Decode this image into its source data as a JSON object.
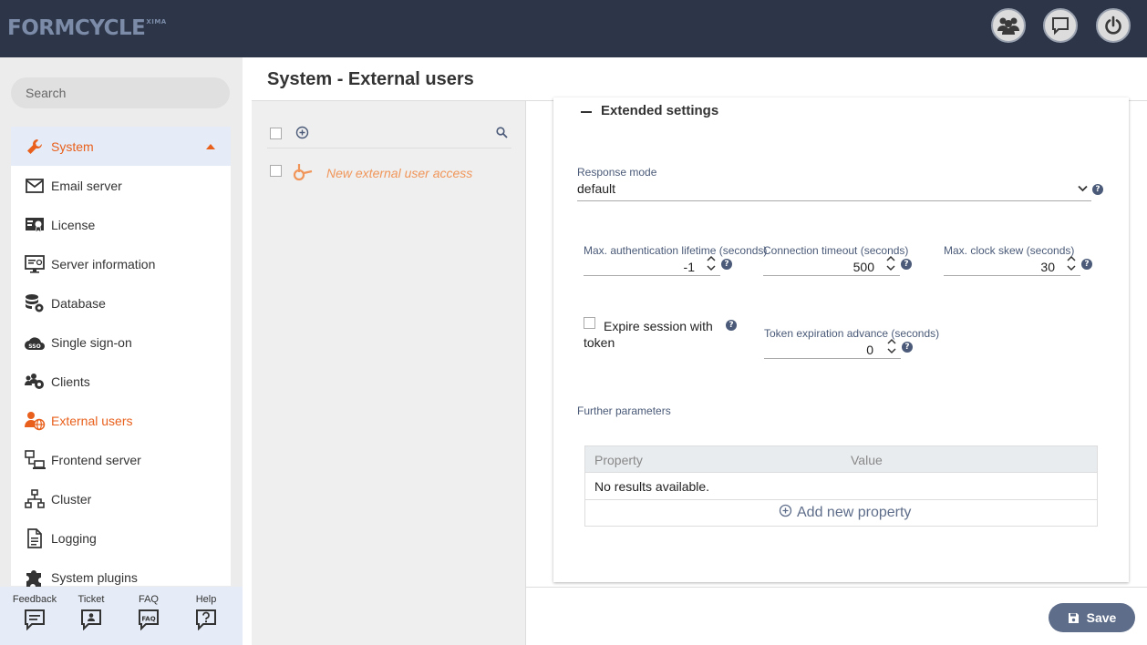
{
  "header": {
    "logo": "FORMCYCLE",
    "logo_sup": "XIMA",
    "buttons": [
      "users-icon",
      "chat-icon",
      "power-icon"
    ]
  },
  "sidebar": {
    "search_placeholder": "Search",
    "system_label": "System",
    "items": [
      {
        "label": "Email server",
        "icon": "envelope-icon"
      },
      {
        "label": "License",
        "icon": "license-icon"
      },
      {
        "label": "Server information",
        "icon": "monitor-info-icon"
      },
      {
        "label": "Database",
        "icon": "database-icon"
      },
      {
        "label": "Single sign-on",
        "icon": "sso-cloud-icon"
      },
      {
        "label": "Clients",
        "icon": "clients-icon"
      },
      {
        "label": "External users",
        "icon": "external-user-icon"
      },
      {
        "label": "Frontend server",
        "icon": "frontend-server-icon"
      },
      {
        "label": "Cluster",
        "icon": "cluster-icon"
      },
      {
        "label": "Logging",
        "icon": "document-icon"
      },
      {
        "label": "System plugins",
        "icon": "puzzle-icon"
      }
    ],
    "footer": [
      {
        "label": "Feedback",
        "icon": "feedback-icon"
      },
      {
        "label": "Ticket",
        "icon": "ticket-icon"
      },
      {
        "label": "FAQ",
        "icon": "faq-icon",
        "icon_text": "FAQ"
      },
      {
        "label": "Help",
        "icon": "help-icon"
      }
    ]
  },
  "page": {
    "title": "System - External users"
  },
  "list": {
    "items": [
      {
        "label": "New external user access"
      }
    ]
  },
  "detail": {
    "section_title": "Extended settings",
    "response_mode": {
      "label": "Response mode",
      "value": "default"
    },
    "auth_lifetime": {
      "label": "Max. authentication lifetime (seconds)",
      "value": "-1"
    },
    "conn_timeout": {
      "label": "Connection timeout (seconds)",
      "value": "500"
    },
    "clock_skew": {
      "label": "Max. clock skew (seconds)",
      "value": "30"
    },
    "expire_session": {
      "label_line1": "Expire session with",
      "label_line2": "token"
    },
    "token_advance": {
      "label": "Token expiration advance (seconds)",
      "value": "0"
    },
    "further_params": "Further parameters",
    "table": {
      "col_property": "Property",
      "col_value": "Value",
      "empty": "No results available.",
      "add": "Add new property"
    },
    "help_glyph": "?",
    "save_label": "Save"
  }
}
